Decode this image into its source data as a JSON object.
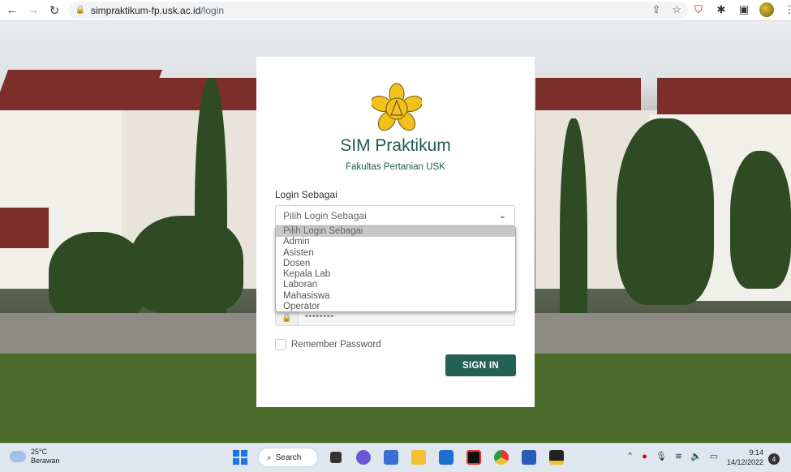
{
  "browser": {
    "url_host": "simpraktikum-fp.usk.ac.id",
    "url_path": "/login"
  },
  "login": {
    "title": "SIM Praktikum",
    "subtitle": "Fakultas Pertanian USK",
    "login_as_label": "Login Sebagai",
    "select_value": "Pilih Login Sebagai",
    "options": [
      "Pilih Login Sebagai",
      "Admin",
      "Asisten",
      "Dosen",
      "Kepala Lab",
      "Laboran",
      "Mahasiswa",
      "Operator"
    ],
    "selected_option_index": 0,
    "password_mask": "••••••••",
    "remember_label": "Remember Password",
    "signin_label": "SIGN IN"
  },
  "taskbar": {
    "temperature": "25°C",
    "weather": "Berawan",
    "search_label": "Search",
    "time": "9:14",
    "date": "14/12/2022",
    "notification_count": "4"
  },
  "colors": {
    "accent": "#236155",
    "title": "#1e5b52"
  }
}
